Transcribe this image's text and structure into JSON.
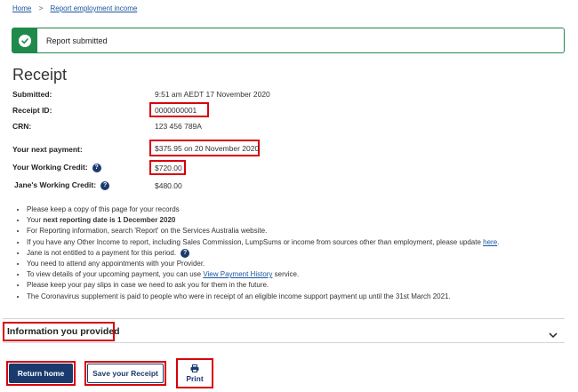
{
  "breadcrumb": {
    "home": "Home",
    "separator": ">",
    "current": "Report employment income"
  },
  "banner": {
    "icon": "check-circle-icon",
    "message": "Report submitted",
    "color": "#1f8a4c"
  },
  "page_title": "Receipt",
  "details": {
    "submitted_label": "Submitted:",
    "submitted_value": "9:51 am AEDT 17 November 2020",
    "receipt_label": "Receipt ID:",
    "receipt_value": "0000000001",
    "crn_label": "CRN:",
    "crn_value": "123 456 789A",
    "next_payment_label": "Your next payment:",
    "next_payment_value": "$375.95 on 20 November 2020",
    "working_credit_label": "Your  Working Credit:",
    "working_credit_value": "$720.00",
    "janes_credit_label": "Jane's Working Credit:",
    "janes_credit_value": "$480.00",
    "help_glyph": "?"
  },
  "notes": [
    "Please keep a copy of this page for your records",
    "Your ",
    "For Reporting information, search 'Report' on the Services Australia website.",
    "If you have any Other Income to report, including Sales Commission, LumpSums or income from sources other than employment, please update ",
    "Jane is not entitled to a payment for this period.",
    "You need to attend any appointments with your Provider.",
    "To view details of your upcoming payment, you can use ",
    "Please keep your pay slips in case we need to ask you for them in the future.",
    "The Coronavirus supplement is paid to people who were in receipt of an eligible income support payment up until the 31st March 2021."
  ],
  "note_parts": {
    "reporting_date_bold": "next reporting date is 1 December 2020",
    "here_link": "here",
    "here_suffix": ".",
    "view_history_link": "View Payment History",
    "view_history_suffix": " service."
  },
  "accordion": {
    "title": "Information you provided",
    "icon": "chevron-down-icon"
  },
  "buttons": {
    "return_home": "Return home",
    "save_receipt": "Save your Receipt",
    "print": "Print",
    "print_icon": "printer-icon"
  },
  "colors": {
    "primary": "#1a3a6e",
    "link": "#1a56a0",
    "highlight": "#d8000c"
  }
}
